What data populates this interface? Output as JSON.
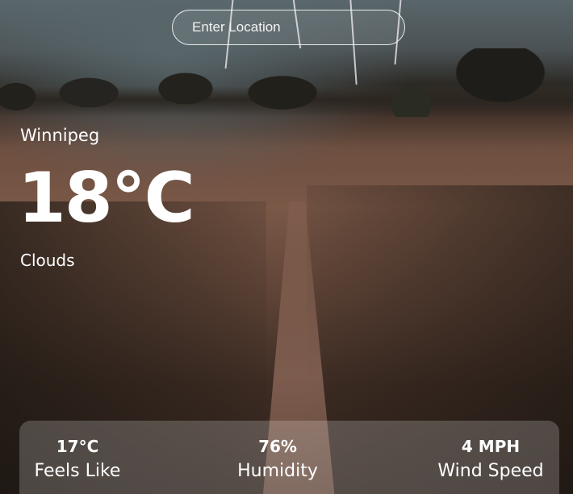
{
  "search": {
    "placeholder": "Enter Location"
  },
  "weather": {
    "city": "Winnipeg",
    "temperature": "18°C",
    "condition": "Clouds"
  },
  "details": [
    {
      "value": "17°C",
      "label": "Feels Like"
    },
    {
      "value": "76%",
      "label": "Humidity"
    },
    {
      "value": "4 MPH",
      "label": "Wind Speed"
    }
  ]
}
